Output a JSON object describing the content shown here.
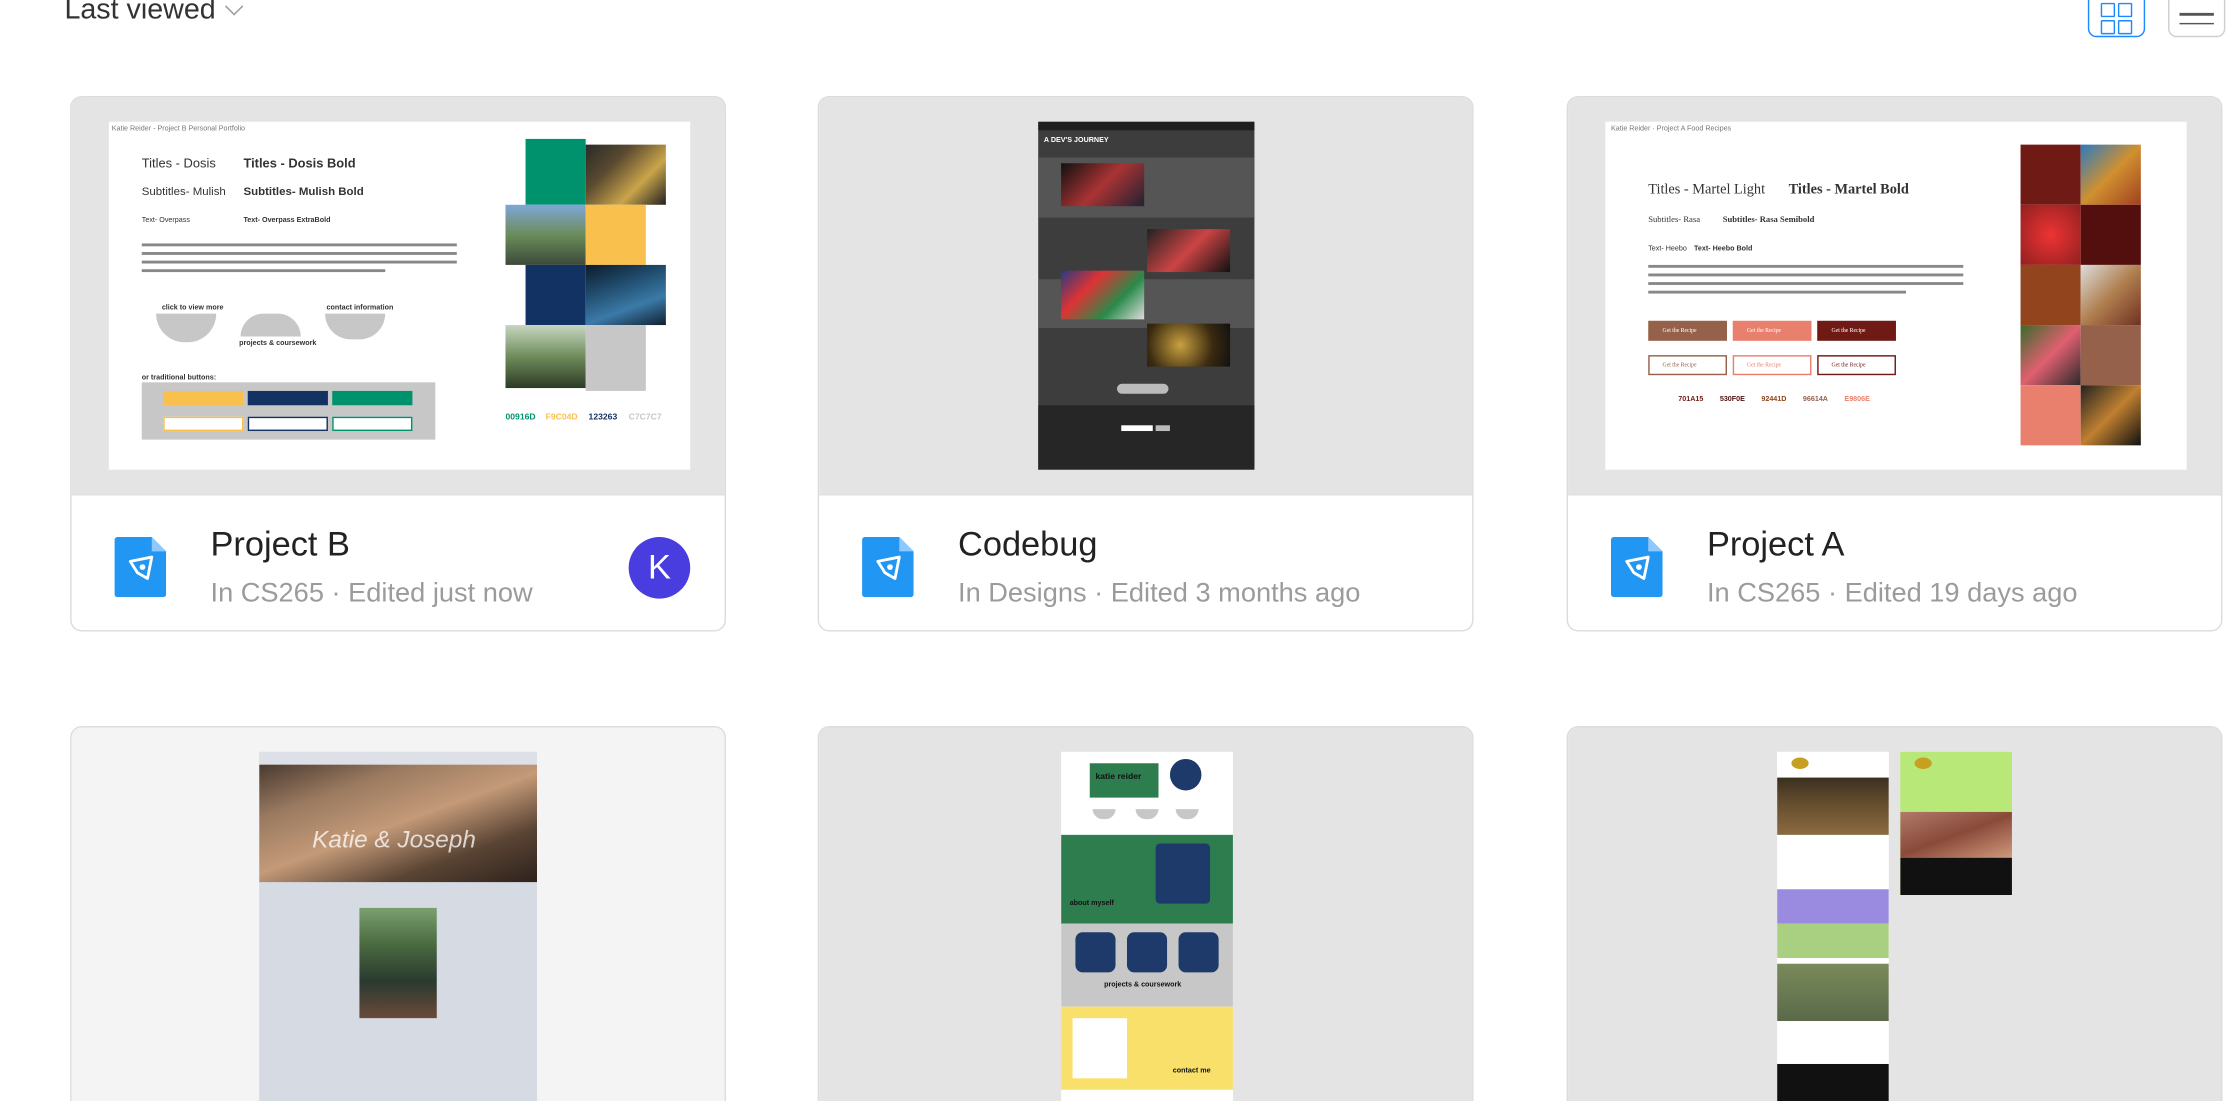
{
  "toolbar": {
    "sort_label": "Last viewed",
    "sort_icon": "chevron-down-icon",
    "view_grid_icon": "grid-view-icon",
    "view_list_icon": "list-view-icon"
  },
  "colors": {
    "accent": "#1e88ff",
    "file_icon": "#2196f3",
    "avatar": "#4a3de0"
  },
  "files": [
    {
      "title": "Project B",
      "project": "In CS265",
      "edited": "Edited just now",
      "sep": "·",
      "avatar": "K"
    },
    {
      "title": "Codebug",
      "project": "In Designs",
      "edited": "Edited 3 months ago",
      "sep": "·"
    },
    {
      "title": "Project A",
      "project": "In CS265",
      "edited": "Edited 19 days ago",
      "sep": "·"
    }
  ],
  "thumbnails": {
    "project_b": {
      "header": "Katie Reider - Project B Personal Portfolio",
      "titles_regular": "Titles - Dosis",
      "titles_bold": "Titles - Dosis Bold",
      "subtitles_regular": "Subtitles- Mulish",
      "subtitles_bold": "Subtitles- Mulish Bold",
      "text_regular": "Text- Overpass",
      "text_bold": "Text- Overpass ExtraBold",
      "click_label": "click to view more",
      "projects_label": "projects & coursework",
      "contact_label": "contact information",
      "traditional_label": "or traditional buttons:",
      "hex": [
        "00916D",
        "F9C04D",
        "123263",
        "C7C7C7"
      ]
    },
    "codebug": {
      "heading": "A DEV'S JOURNEY"
    },
    "project_a": {
      "header": "Katie Reider · Project A Food Recipes",
      "titles_light": "Titles - Martel Light",
      "titles_bold": "Titles - Martel Bold",
      "subtitles_regular": "Subtitles- Rasa",
      "subtitles_bold": "Subtitles- Rasa Semibold",
      "text_regular": "Text- Heebo",
      "text_bold": "Text- Heebo Bold",
      "button_label": "Get the Recipe",
      "hex": [
        "701A15",
        "530F0E",
        "92441D",
        "96614A",
        "E9806E"
      ]
    },
    "wedding": {
      "names": "Katie & Joseph"
    },
    "portfolio": {
      "name": "katie reider",
      "about": "about myself",
      "projects": "projects & coursework",
      "contact": "contact me"
    }
  }
}
